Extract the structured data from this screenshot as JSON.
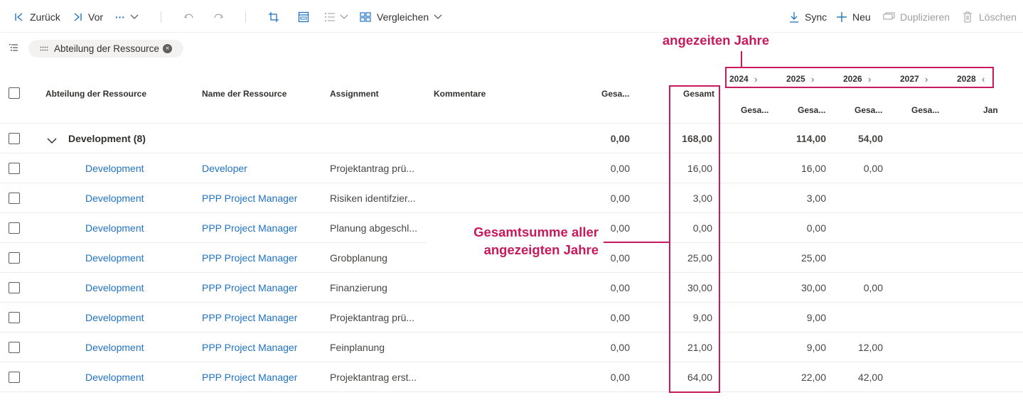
{
  "toolbar": {
    "back_label": "Zurück",
    "forward_label": "Vor",
    "more_label": "···",
    "compare_label": "Vergleichen",
    "sync_label": "Sync",
    "new_label": "Neu",
    "duplicate_label": "Duplizieren",
    "delete_label": "Löschen"
  },
  "grouping": {
    "chip_label": "Abteilung der Ressource",
    "chip_remove": "×"
  },
  "columns": {
    "department": "Abteilung der Ressource",
    "resource": "Name der Ressource",
    "assignment": "Assignment",
    "comments": "Kommentare",
    "gesamt_short": "Gesa...",
    "gesamt": "Gesamt",
    "sub_2024": "Gesa...",
    "sub_2025": "Gesa...",
    "sub_2026": "Gesa...",
    "sub_2027": "Gesa...",
    "sub_2028": "Jan"
  },
  "years": [
    "2024",
    "2025",
    "2026",
    "2027",
    "2028"
  ],
  "group": {
    "label": "Development (8)",
    "gesa": "0,00",
    "gesamt": "168,00",
    "y2025": "114,00",
    "y2026": "54,00"
  },
  "rows": [
    {
      "dept": "Development",
      "resource": "Developer",
      "assignment": "Projektantrag prü...",
      "gesa": "0,00",
      "gesamt": "16,00",
      "y2025": "16,00",
      "y2026": "0,00"
    },
    {
      "dept": "Development",
      "resource": "PPP Project Manager",
      "assignment": "Risiken identifzier...",
      "gesa": "0,00",
      "gesamt": "3,00",
      "y2025": "3,00",
      "y2026": ""
    },
    {
      "dept": "Development",
      "resource": "PPP Project Manager",
      "assignment": "Planung abgeschl...",
      "gesa": "0,00",
      "gesamt": "0,00",
      "y2025": "0,00",
      "y2026": ""
    },
    {
      "dept": "Development",
      "resource": "PPP Project Manager",
      "assignment": "Grobplanung",
      "gesa": "0,00",
      "gesamt": "25,00",
      "y2025": "25,00",
      "y2026": ""
    },
    {
      "dept": "Development",
      "resource": "PPP Project Manager",
      "assignment": "Finanzierung",
      "gesa": "0,00",
      "gesamt": "30,00",
      "y2025": "30,00",
      "y2026": "0,00"
    },
    {
      "dept": "Development",
      "resource": "PPP Project Manager",
      "assignment": "Projektantrag prü...",
      "gesa": "0,00",
      "gesamt": "9,00",
      "y2025": "9,00",
      "y2026": ""
    },
    {
      "dept": "Development",
      "resource": "PPP Project Manager",
      "assignment": "Feinplanung",
      "gesa": "0,00",
      "gesamt": "21,00",
      "y2025": "9,00",
      "y2026": "12,00"
    },
    {
      "dept": "Development",
      "resource": "PPP Project Manager",
      "assignment": "Projektantrag erst...",
      "gesa": "0,00",
      "gesamt": "64,00",
      "y2025": "22,00",
      "y2026": "42,00"
    }
  ],
  "annotations": {
    "years_label": "angezeiten Jahre",
    "total_label_line1": "Gesamtsumme aller",
    "total_label_line2": "angezeigten Jahre",
    "color": "#c7195b"
  }
}
